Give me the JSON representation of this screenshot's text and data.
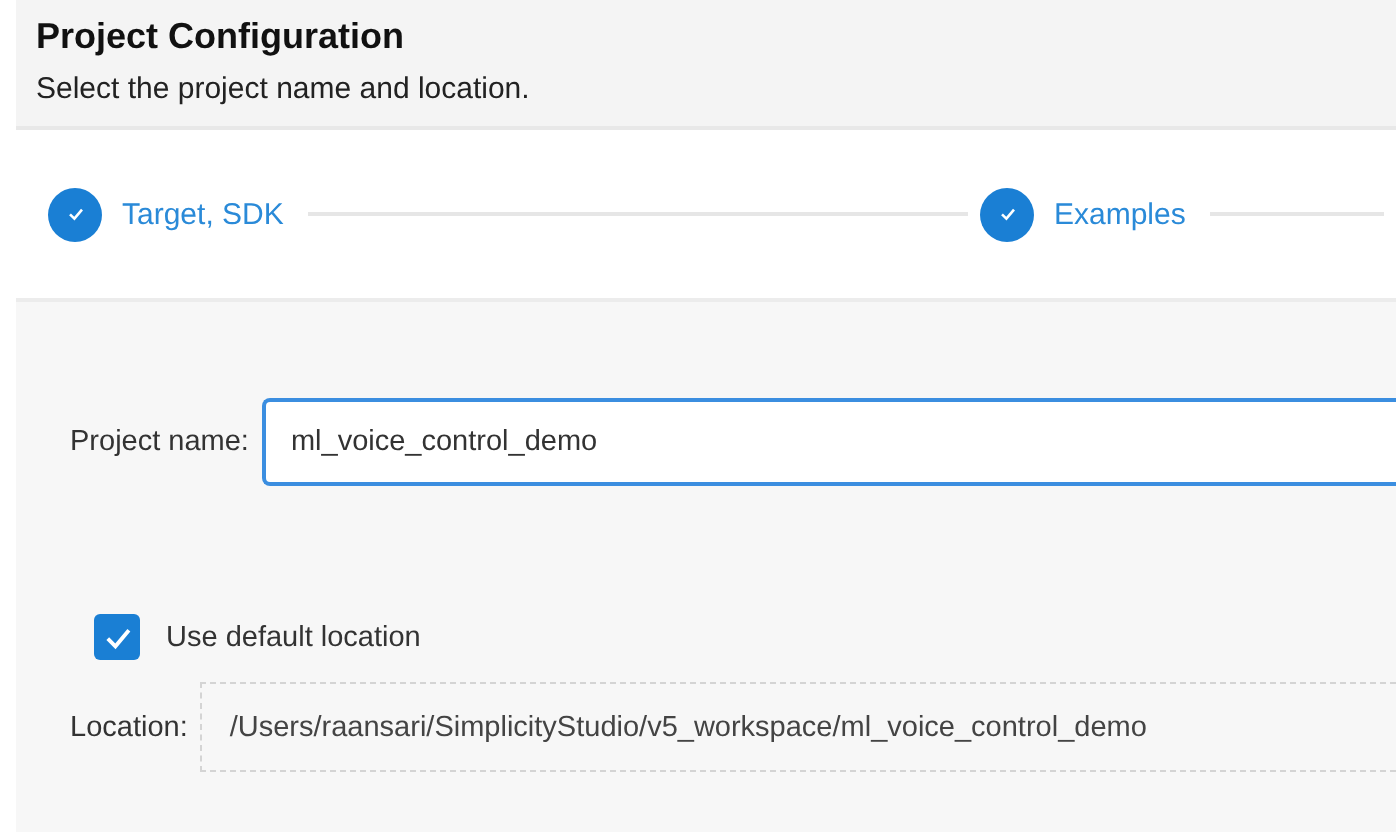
{
  "header": {
    "title": "Project Configuration",
    "subtitle": "Select the project name and location."
  },
  "steps": [
    {
      "label": "Target, SDK",
      "completed": true
    },
    {
      "label": "Examples",
      "completed": true
    }
  ],
  "project_name": {
    "label": "Project name:",
    "value": "ml_voice_control_demo",
    "focused": true
  },
  "use_default_location": {
    "label": "Use default location",
    "checked": true
  },
  "location": {
    "label": "Location:",
    "value": "/Users/raansari/SimplicityStudio/v5_workspace/ml_voice_control_demo",
    "disabled": true
  }
}
